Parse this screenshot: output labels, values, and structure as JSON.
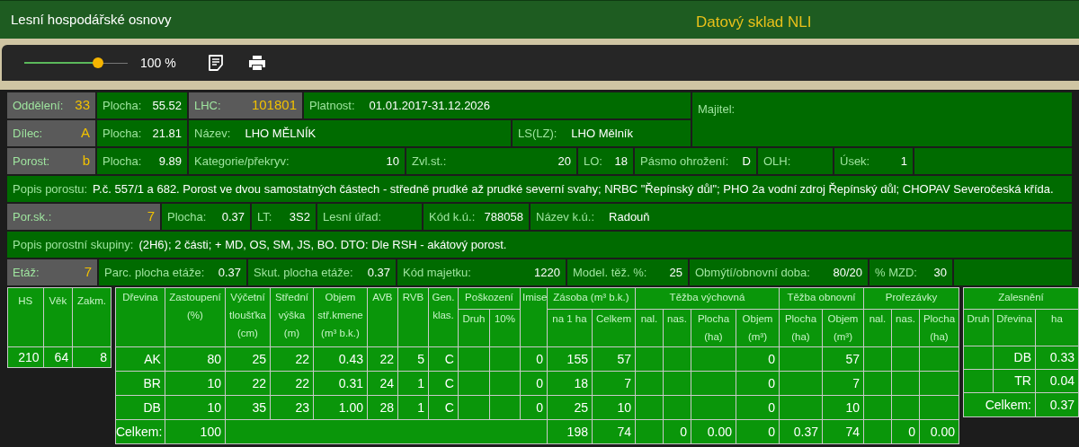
{
  "header": {
    "title": "Lesní hospodářské osnovy",
    "brand": "Datový sklad NLI"
  },
  "toolbar": {
    "zoom": {
      "level": 0.71,
      "reading": "100 %"
    }
  },
  "info": {
    "top_rows": [
      [
        {
          "kind": "key",
          "label": "Oddělení:",
          "value": "33"
        },
        {
          "kind": "pair",
          "label": "Plocha:",
          "value": "55.52"
        },
        {
          "kind": "key",
          "label": "LHC:",
          "value": "101801"
        },
        {
          "kind": "inline",
          "label": "Platnost:",
          "value": "01.01.2017-31.12.2026"
        }
      ],
      [
        {
          "kind": "key",
          "label": "Dílec:",
          "value": "A"
        },
        {
          "kind": "pair",
          "label": "Plocha:",
          "value": "21.81"
        },
        {
          "kind": "inline",
          "label": "Název:",
          "value": "LHO MĚLNÍK"
        },
        {
          "kind": "inline",
          "label": "LS(LZ):",
          "value": "LHO Mělník"
        }
      ]
    ],
    "owner": {
      "label": "Majitel:"
    },
    "rows": [
      {
        "kind": "cells",
        "cells": [
          {
            "kind": "key",
            "label": "Porost:",
            "value": "b"
          },
          {
            "kind": "pair",
            "label": "Plocha:",
            "value": "9.89"
          },
          {
            "kind": "pair",
            "label": "Kategorie/překryv:",
            "value": "10"
          },
          {
            "kind": "pair",
            "label": "Zvl.st.:",
            "value": "20"
          },
          {
            "kind": "pair",
            "label": "LO:",
            "value": "18"
          },
          {
            "kind": "pair",
            "label": "Pásmo ohrožení:",
            "value": "D"
          },
          {
            "kind": "label",
            "label": "OLH:"
          },
          {
            "kind": "pair",
            "label": "Úsek:",
            "value": "1"
          }
        ]
      },
      {
        "kind": "note",
        "label": "Popis porostu:",
        "text": "P.č. 557/1 a 682. Porost ve dvou samostatných částech - středně prudké až prudké severní svahy; NRBC \"Řepínský důl\"; PHO 2a vodní zdroj Řepínský důl; CHOPAV Severočeská křída."
      },
      {
        "kind": "cells",
        "cells": [
          {
            "kind": "key",
            "label": "Por.sk.:",
            "value": "7"
          },
          {
            "kind": "pair",
            "label": "Plocha:",
            "value": "0.37"
          },
          {
            "kind": "pair",
            "label": "LT:",
            "value": "3S2"
          },
          {
            "kind": "label",
            "label": "Lesní úřad:"
          },
          {
            "kind": "pair",
            "label": "Kód k.ú.:",
            "value": "788058"
          },
          {
            "kind": "inline",
            "label": "Název k.ú.:",
            "value": "Radouň"
          }
        ]
      },
      {
        "kind": "note",
        "label": "Popis porostní skupiny:",
        "text": "(2H6); 2 části; + MD, OS, SM, JS, BO. DTO: Dle RSH - akátový porost."
      },
      {
        "kind": "cells",
        "cells": [
          {
            "kind": "key",
            "label": "Etáž:",
            "value": "7"
          },
          {
            "kind": "pair",
            "label": "Parc. plocha etáže:",
            "value": "0.37"
          },
          {
            "kind": "pair",
            "label": "Skut. plocha etáže:",
            "value": "0.37"
          },
          {
            "kind": "pair",
            "label": "Kód majetku:",
            "value": "1220"
          },
          {
            "kind": "pair",
            "label": "Model. těž. %:",
            "value": "25"
          },
          {
            "kind": "pair",
            "label": "Obmýtí/obnovní doba:",
            "value": "80/20"
          },
          {
            "kind": "pair",
            "label": "% MZD:",
            "value": "30"
          }
        ]
      }
    ]
  },
  "stand_table": {
    "columns": [
      "HS",
      "Věk",
      "Zakm."
    ],
    "rows": [
      [
        "210",
        "64",
        "8"
      ]
    ]
  },
  "species_table": {
    "column_groups": [
      "Poškození",
      "Zásoba (m³ b.k.)",
      "Těžba výchovná",
      "Těžba obnovní",
      "Prořezávky"
    ],
    "columns": [
      "Dřevina",
      "Zastoupení (%)",
      "Výčetní tloušťka (cm)",
      "Střední výška (m)",
      "Objem stř.kmene (m³ b.k.)",
      "AVB",
      "RVB",
      "Gen. klas.",
      "Druh",
      "10%",
      "Imise",
      "na 1 ha",
      "Celkem",
      "nal.",
      "nas.",
      "Plocha (ha)",
      "Objem (m³)",
      "Plocha (ha)",
      "Objem (m³)",
      "nal.",
      "nas.",
      "Plocha (ha)"
    ],
    "rows": [
      [
        "AK",
        "80",
        "25",
        "22",
        "0.43",
        "22",
        "5",
        "C",
        null,
        null,
        "0",
        "155",
        "57",
        null,
        null,
        null,
        "0",
        null,
        "57",
        null,
        null,
        null
      ],
      [
        "BR",
        "10",
        "22",
        "22",
        "0.31",
        "24",
        "1",
        "C",
        null,
        null,
        "0",
        "18",
        "7",
        null,
        null,
        null,
        "0",
        null,
        "7",
        null,
        null,
        null
      ],
      [
        "DB",
        "10",
        "35",
        "23",
        "1.00",
        "28",
        "1",
        "C",
        null,
        null,
        "0",
        "25",
        "10",
        null,
        null,
        null,
        "0",
        null,
        "10",
        null,
        null,
        null
      ]
    ],
    "total": {
      "label": "Celkem:",
      "share": "100",
      "cells": [
        "198",
        "74",
        null,
        "0",
        "0.00",
        "0",
        "0.37",
        "74",
        null,
        "0",
        "0.00"
      ]
    }
  },
  "afforestation_table": {
    "title": "Zalesnění",
    "columns": [
      "Druh",
      "Dřevina",
      "ha"
    ],
    "rows": [
      [
        null,
        "DB",
        "0.33"
      ],
      [
        null,
        "TR",
        "0.04"
      ]
    ],
    "total": {
      "label": "Celkem:",
      "value": "0.37"
    }
  }
}
